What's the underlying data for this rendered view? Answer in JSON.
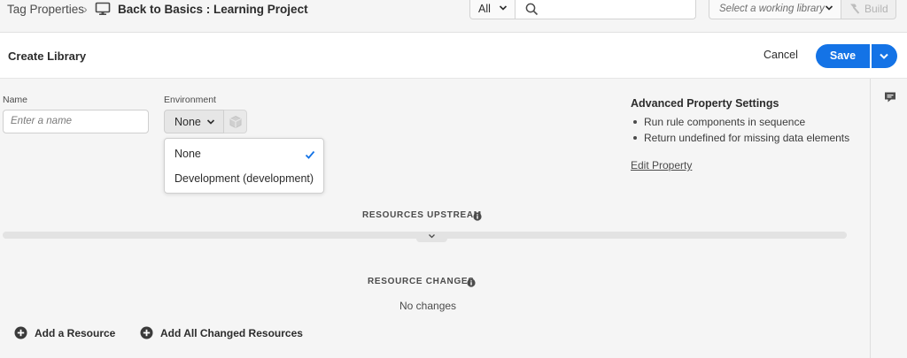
{
  "topbar": {
    "breadcrumb_root": "Tag Properties",
    "breadcrumb_separator": "›",
    "property_title": "Back to Basics : Learning Project",
    "scope_value": "All",
    "search_placeholder": "",
    "library_placeholder": "Select a working library",
    "build_label": "Build",
    "icons": {
      "property": "monitor-icon",
      "search": "search-icon",
      "build": "hammer-icon"
    }
  },
  "header": {
    "title": "Create Library",
    "cancel_label": "Cancel",
    "save_label": "Save"
  },
  "form": {
    "name_label": "Name",
    "name_placeholder": "Enter a name",
    "environment_label": "Environment",
    "environment_value": "None",
    "environment_options": [
      {
        "label": "None",
        "selected": true
      },
      {
        "label": "Development (development)",
        "selected": false
      }
    ]
  },
  "advanced": {
    "title": "Advanced Property Settings",
    "items": [
      "Run rule components in sequence",
      "Return undefined for missing data elements"
    ],
    "edit_link": "Edit Property"
  },
  "sections": {
    "upstream_title": "RESOURCES UPSTREAM",
    "changes_title": "RESOURCE CHANGES",
    "no_changes": "No changes"
  },
  "actions": {
    "add_resource": "Add a Resource",
    "add_all": "Add All Changed Resources"
  },
  "colors": {
    "accent": "#1473e6",
    "background": "#f5f5f5"
  }
}
